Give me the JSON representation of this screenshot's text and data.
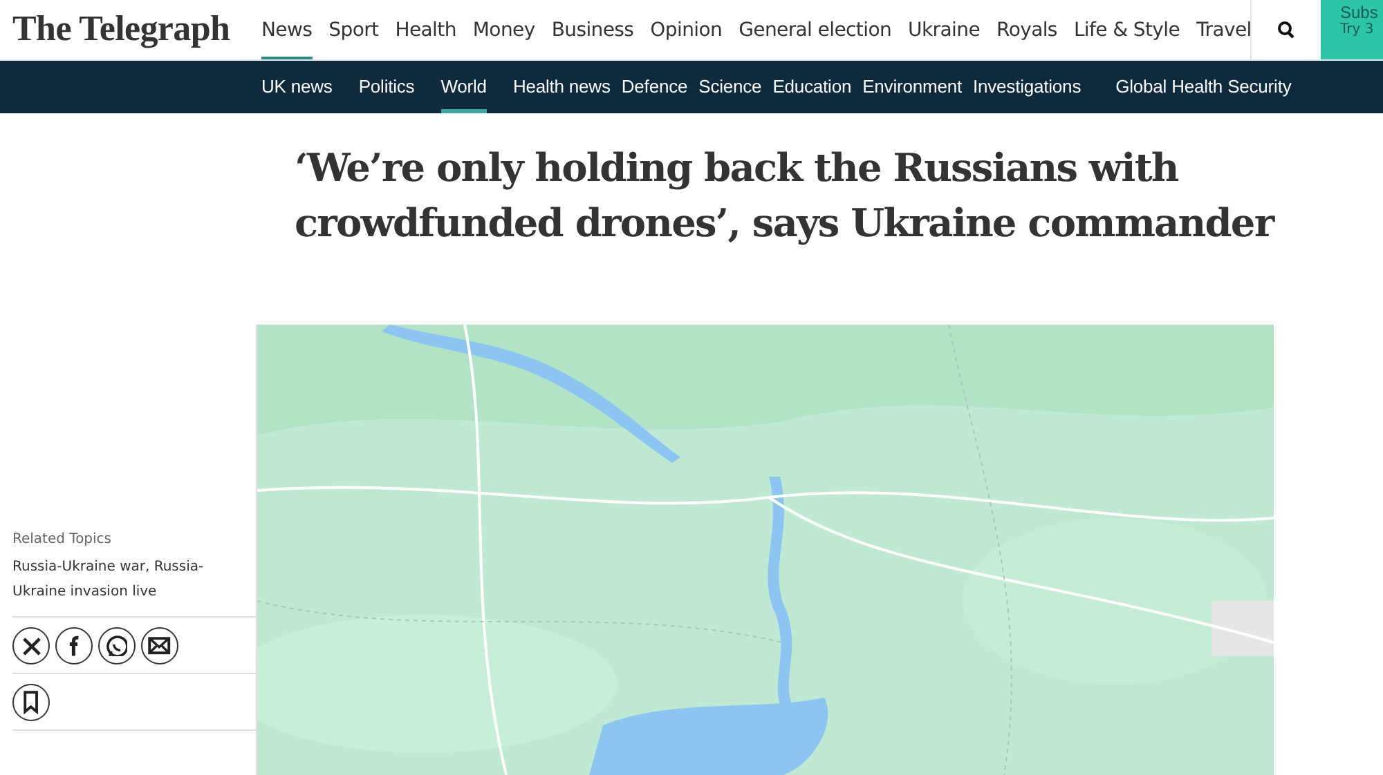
{
  "masthead": {
    "logo": "The Telegraph",
    "nav": [
      {
        "label": "News",
        "selected": true
      },
      {
        "label": "Sport",
        "selected": false
      },
      {
        "label": "Health",
        "selected": false
      },
      {
        "label": "Money",
        "selected": false
      },
      {
        "label": "Business",
        "selected": false
      },
      {
        "label": "Opinion",
        "selected": false
      },
      {
        "label": "General election",
        "selected": false
      },
      {
        "label": "Ukraine",
        "selected": false
      },
      {
        "label": "Royals",
        "selected": false
      },
      {
        "label": "Life & Style",
        "selected": false
      },
      {
        "label": "Travel",
        "selected": false
      }
    ],
    "subscribe": {
      "label": "Subs",
      "sub": "Try 3"
    }
  },
  "subnav": [
    {
      "label": "UK news",
      "selected": false
    },
    {
      "label": "Politics",
      "selected": false
    },
    {
      "label": "World",
      "selected": true
    },
    {
      "label": "Health news",
      "selected": false
    },
    {
      "label": "Defence",
      "selected": false
    },
    {
      "label": "Science",
      "selected": false
    },
    {
      "label": "Education",
      "selected": false
    },
    {
      "label": "Environment",
      "selected": false
    },
    {
      "label": "Investigations",
      "selected": false
    },
    {
      "label": "Global Health Security",
      "selected": false
    }
  ],
  "article": {
    "headline": "‘We’re only holding back the Russians with crowdfunded drones’, says Ukraine commander"
  },
  "sidebar": {
    "related_heading": "Related Topics",
    "related_links": "Russia-Ukraine war, Russia-Ukraine invasion live",
    "share": [
      {
        "kind": "x"
      },
      {
        "kind": "facebook"
      },
      {
        "kind": "whatsapp"
      },
      {
        "kind": "email"
      }
    ],
    "actions": [
      {
        "kind": "bookmark"
      }
    ]
  }
}
